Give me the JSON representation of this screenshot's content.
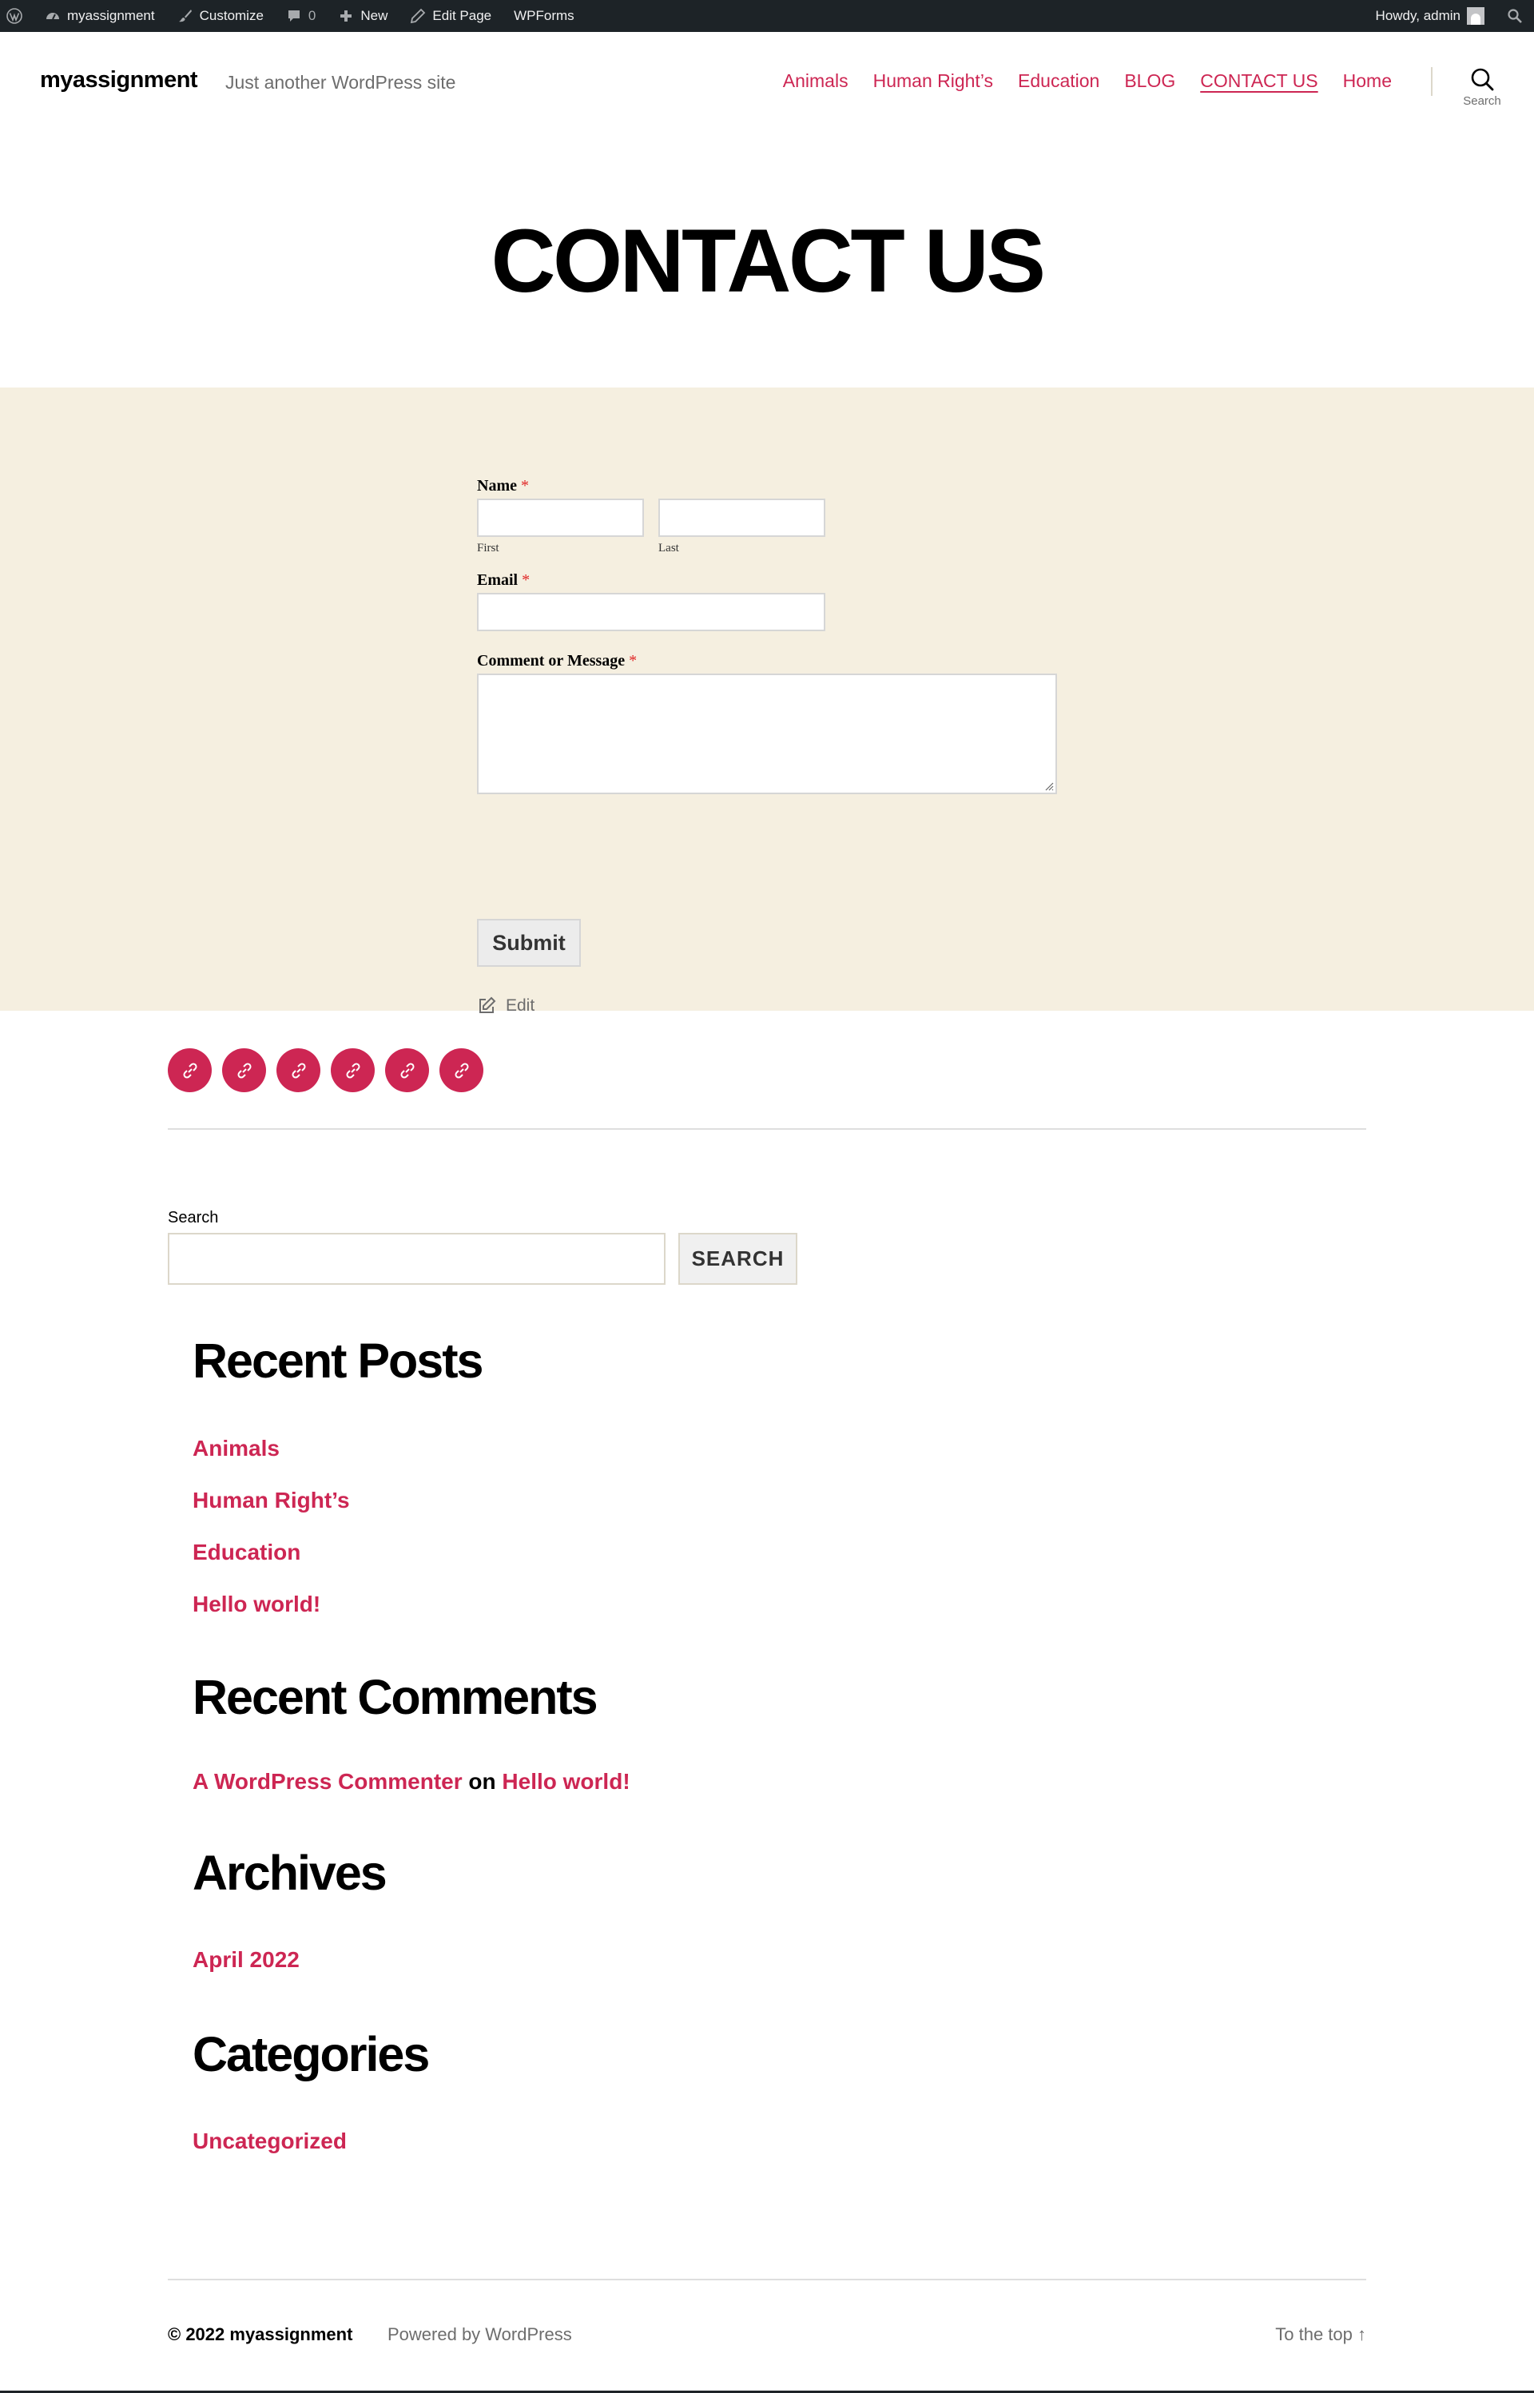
{
  "adminbar": {
    "site_name": "myassignment",
    "customize": "Customize",
    "comments_count": "0",
    "new": "New",
    "edit_page": "Edit Page",
    "wpforms": "WPForms",
    "howdy": "Howdy, admin"
  },
  "header": {
    "site_title": "myassignment",
    "description": "Just another WordPress site",
    "nav": [
      "Animals",
      "Human Right’s",
      "Education",
      "BLOG",
      "CONTACT US",
      "Home"
    ],
    "search_label": "Search"
  },
  "page": {
    "title": "CONTACT US"
  },
  "form": {
    "name_label": "Name",
    "required_mark": "*",
    "first_sub": "First",
    "last_sub": "Last",
    "email_label": "Email",
    "message_label": "Comment or Message",
    "submit": "Submit",
    "edit": "Edit"
  },
  "search_widget": {
    "label": "Search",
    "button": "SEARCH"
  },
  "recent_posts": {
    "title": "Recent Posts",
    "items": [
      "Animals",
      "Human Right’s",
      "Education",
      "Hello world!"
    ]
  },
  "recent_comments": {
    "title": "Recent Comments",
    "author": "A WordPress Commenter",
    "on": "on",
    "post": "Hello world!"
  },
  "archives": {
    "title": "Archives",
    "items": [
      "April 2022"
    ]
  },
  "categories": {
    "title": "Categories",
    "items": [
      "Uncategorized"
    ]
  },
  "footer": {
    "copyright": "© 2022 myassignment",
    "powered": "Powered by WordPress",
    "to_top": "To the top ↑"
  },
  "colors": {
    "accent": "#cd2653",
    "admin_bar": "#1d2327",
    "form_bg": "#f5efe0"
  }
}
